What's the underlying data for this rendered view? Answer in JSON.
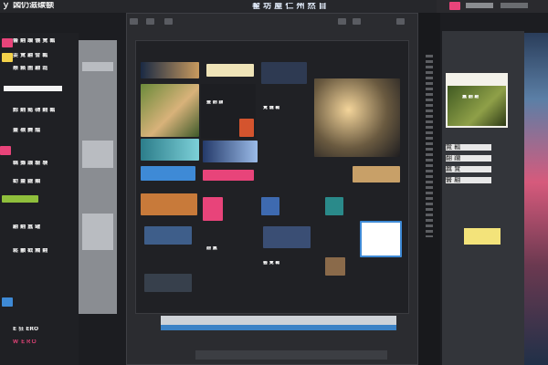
{
  "app": {
    "title": "ｙ 図仍滋碳额",
    "window_title": "翟 坊 屋 仁 州 然 目"
  },
  "left_panel": {
    "rows": [
      "醫 翻 躪 儀 覽 瓤",
      "耍 覽 翩 譬 瓤",
      "懸 籟 圖 翩 磊",
      "黥 翻 懿 礴 翻 瓤",
      "靈 襯 爨 醞",
      "黐 攤 譏 驗 襲",
      "勸 靈 鼴 顯",
      "翩 翻 蠶 罐",
      "鬆 籲 戳 觸 翻",
      "E 狂 ERO",
      "Ｗ ＥＲＯ"
    ]
  },
  "main_window": {
    "cards": [
      {
        "caption": "靈 翻 鼴"
      },
      {
        "caption": "覽 籠 瓤"
      },
      {
        "caption": "翻 蠶"
      },
      {
        "caption": "醫 覽 瓤"
      }
    ]
  },
  "right_panel": {
    "card_caption": "蠶 翻 翩",
    "items": [
      "覽 瓤",
      "翻 躪",
      "蠶 覽",
      "醫 翩"
    ]
  },
  "colors": {
    "accent_pink": "#e8447a",
    "accent_blue": "#3d83c6",
    "accent_yellow": "#f3e37a"
  }
}
